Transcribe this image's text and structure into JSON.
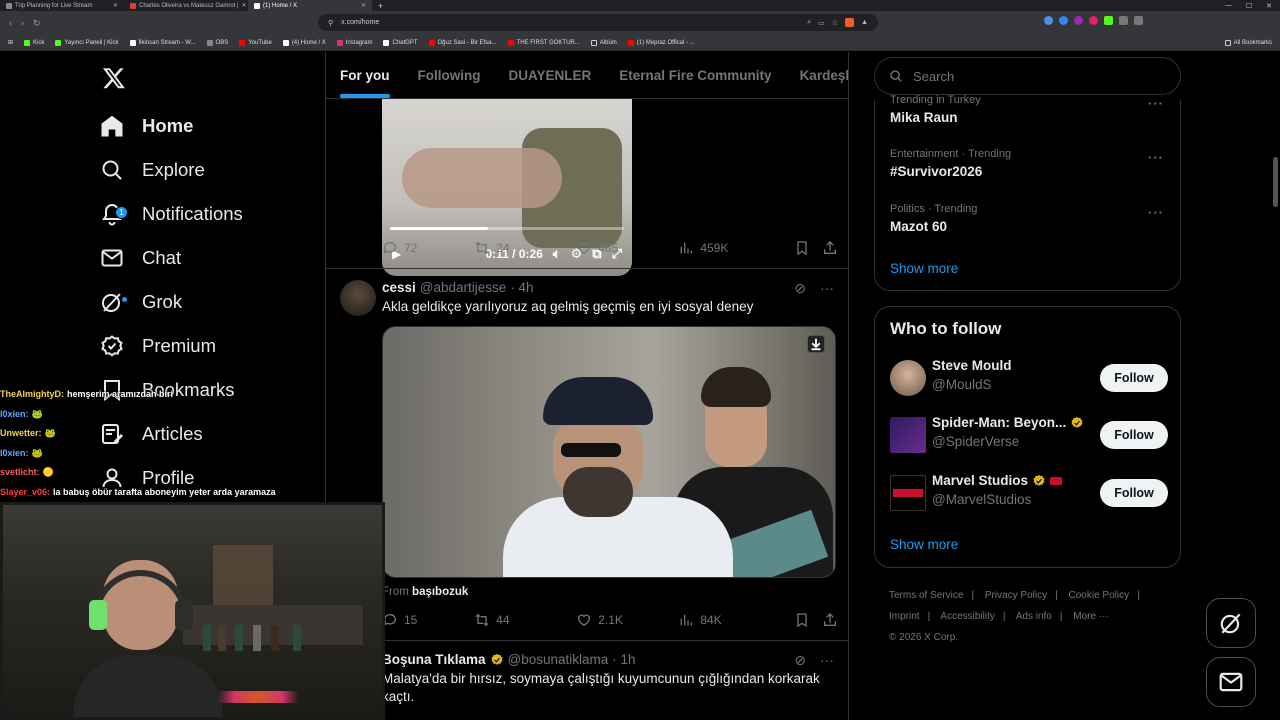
{
  "browser": {
    "tabs": [
      {
        "label": "Trip Planning for Live Stream",
        "icon": "tab-favicon",
        "active": false
      },
      {
        "label": "Charles Oliveira vs Mateusz Gamrot |",
        "icon": "youtube-icon",
        "active": false
      },
      {
        "label": "(1) Home / X",
        "icon": "x-icon",
        "active": true
      }
    ],
    "url": "x.com/home",
    "bookmarks": [
      {
        "label": "Kick",
        "icon": "kick-icon"
      },
      {
        "label": "Yayıncı Paneli | Kick",
        "icon": "kick-icon"
      },
      {
        "label": "İlkinsan Stream - W...",
        "icon": "twitch-icon"
      },
      {
        "label": "OBS",
        "icon": "obs-icon"
      },
      {
        "label": "YouTube",
        "icon": "youtube-icon"
      },
      {
        "label": "(4) Home / X",
        "icon": "x-icon"
      },
      {
        "label": "Instagram",
        "icon": "instagram-icon"
      },
      {
        "label": "ChatGPT",
        "icon": "chatgpt-icon"
      },
      {
        "label": "Oğuz Sasi - Bir Efsa...",
        "icon": "youtube-icon"
      },
      {
        "label": "THE FIRST GOKTUR...",
        "icon": "youtube-icon"
      },
      {
        "label": "Albüm",
        "icon": "folder-icon"
      },
      {
        "label": "(1) Mepraz Offical - ...",
        "icon": "youtube-icon"
      }
    ],
    "all_bookmarks": "All Bookmarks"
  },
  "nav": {
    "items": [
      {
        "label": "Home",
        "icon": "home-icon"
      },
      {
        "label": "Explore",
        "icon": "search-icon"
      },
      {
        "label": "Notifications",
        "icon": "bell-icon",
        "badge": "1"
      },
      {
        "label": "Chat",
        "icon": "mail-icon"
      },
      {
        "label": "Grok",
        "icon": "grok-icon"
      },
      {
        "label": "Premium",
        "icon": "premium-icon"
      },
      {
        "label": "Bookmarks",
        "icon": "bookmark-icon"
      },
      {
        "label": "Articles",
        "icon": "article-icon"
      },
      {
        "label": "Profile",
        "icon": "profile-icon"
      }
    ]
  },
  "timeline": {
    "tabs": [
      "For you",
      "Following",
      "DUAYENLER",
      "Eternal Fire Community",
      "Kardeşler K"
    ],
    "video1": {
      "time": "0:11 / 0:26",
      "progress": 0.42
    },
    "post1_actions": {
      "replies": "72",
      "reposts": "24",
      "likes": "465",
      "views": "459K"
    },
    "post2": {
      "name": "cessi",
      "handle": "@abdartijesse",
      "time": "· 4h",
      "text": "Akla geldikçe yarılıyoruz aq gelmiş geçmiş en iyi sosyal deney",
      "from_prefix": "From",
      "from_account": "başıbozuk",
      "replies": "15",
      "reposts": "44",
      "likes": "2.1K",
      "views": "84K"
    },
    "post3": {
      "name": "Boşuna Tıklama",
      "handle": "@bosunatiklama",
      "time": "· 1h",
      "text": "Malatya'da bir hırsız, soymaya çalıştığı kuyumcunun çığlığından korkarak kaçtı."
    }
  },
  "search": {
    "placeholder": "Search"
  },
  "trends": {
    "items": [
      {
        "category": "Trending in Turkey",
        "name": "Mika Raun"
      },
      {
        "category": "Entertainment · Trending",
        "name": "#Survivor2026"
      },
      {
        "category": "Politics · Trending",
        "name": "Mazot 60"
      }
    ],
    "show_more": "Show more"
  },
  "who_to_follow": {
    "title": "Who to follow",
    "items": [
      {
        "name": "Steve Mould",
        "handle": "@MouldS",
        "button": "Follow"
      },
      {
        "name": "Spider-Man: Beyon...",
        "handle": "@SpiderVerse",
        "button": "Follow"
      },
      {
        "name": "Marvel Studios",
        "handle": "@MarvelStudios",
        "button": "Follow"
      }
    ],
    "show_more": "Show more"
  },
  "footer": {
    "links": [
      "Terms of Service",
      "Privacy Policy",
      "Cookie Policy",
      "Imprint",
      "Accessibility",
      "Ads info",
      "More ···"
    ],
    "copyright": "© 2026 X Corp."
  },
  "chat": [
    {
      "user": "TheAlmightyD:",
      "msg": "hemşerim aramızdan biri",
      "color": "#f5d34a"
    },
    {
      "user": "l0xien:",
      "msg": "🐸",
      "color": "#5fa8ff"
    },
    {
      "user": "Unwetter:",
      "msg": "🐸",
      "color": "#f5d34a"
    },
    {
      "user": "l0xien:",
      "msg": "🐸",
      "color": "#5fa8ff"
    },
    {
      "user": "svetlicht:",
      "msg": "🟡",
      "color": "#ff5c5c"
    },
    {
      "user": "Slayer_v06:",
      "msg": "la babuş öbür tarafta aboneyim yeter arda yaramaza",
      "color": "#ff3b3b"
    }
  ],
  "colors": {
    "accent": "#1d9bf0",
    "bg": "#000000",
    "border": "#2f3336",
    "muted": "#71767b"
  }
}
